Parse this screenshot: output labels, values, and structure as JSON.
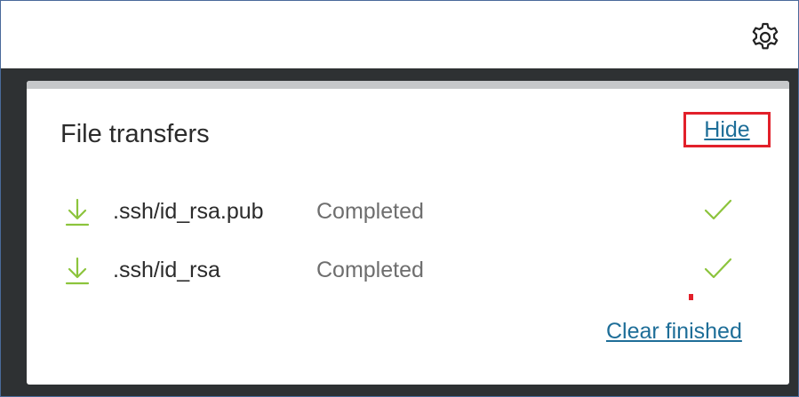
{
  "header": {
    "settings_icon": "gear-icon"
  },
  "panel": {
    "title": "File transfers",
    "hide_label": "Hide",
    "clear_label": "Clear finished",
    "accent_color": "#1e6e98",
    "success_color": "#8cc43c",
    "highlight_color": "#e2202a"
  },
  "transfers": [
    {
      "file": ".ssh/id_rsa.pub",
      "status": "Completed",
      "icon": "download-icon",
      "status_icon": "checkmark-icon"
    },
    {
      "file": ".ssh/id_rsa",
      "status": "Completed",
      "icon": "download-icon",
      "status_icon": "checkmark-icon"
    }
  ]
}
